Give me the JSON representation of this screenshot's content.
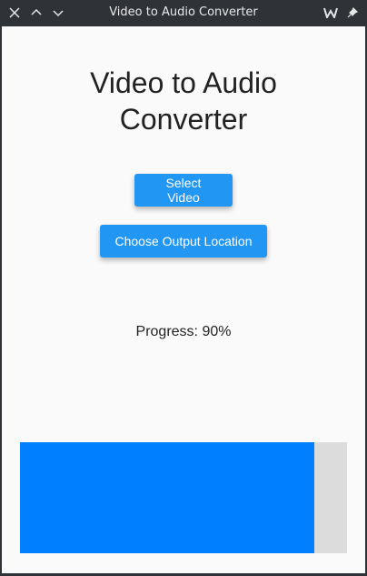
{
  "window": {
    "title": "Video to Audio Converter",
    "controls": {
      "close": "close-icon",
      "minimize": "chevron-up-icon",
      "maximize": "chevron-down-icon",
      "app_menu": "app-logo-icon",
      "pin": "pin-icon"
    }
  },
  "app": {
    "heading": "Video to Audio Converter",
    "select_video_label": "Select Video",
    "choose_output_label": "Choose Output Location",
    "progress_text": "Progress: 90%",
    "progress_value": 0.9
  },
  "colors": {
    "accent": "#2196f3",
    "progress_fill": "#0080ff",
    "progress_track": "#dcdcdc",
    "background": "#fafafa",
    "titlebar": "#2f3338"
  }
}
